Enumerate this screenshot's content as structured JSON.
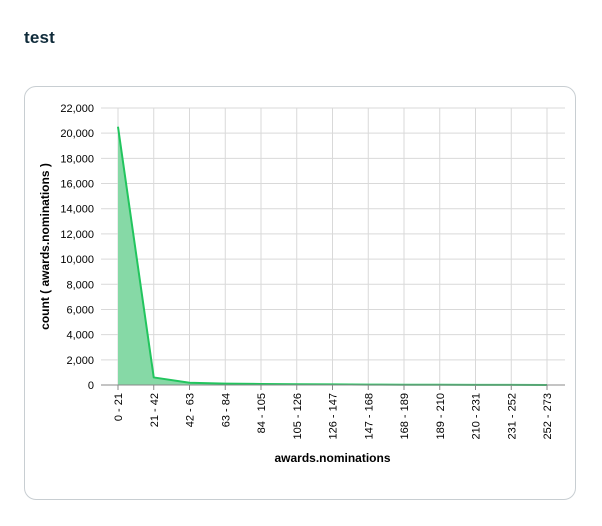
{
  "page": {
    "title": "test"
  },
  "colors": {
    "line": "#22c55e",
    "area": "#86d9a6"
  },
  "chart_data": {
    "type": "area",
    "title": "",
    "xlabel": "awards.nominations",
    "ylabel": "count ( awards.nominations )",
    "categories": [
      "0 - 21",
      "21 - 42",
      "42 - 63",
      "63 - 84",
      "84 - 105",
      "105 - 126",
      "126 - 147",
      "147 - 168",
      "168 - 189",
      "189 - 210",
      "210 - 231",
      "231 - 252",
      "252 - 273"
    ],
    "values": [
      20500,
      600,
      180,
      110,
      80,
      60,
      45,
      30,
      20,
      15,
      10,
      5,
      3
    ],
    "yticks": [
      "0",
      "2,000",
      "4,000",
      "6,000",
      "8,000",
      "10,000",
      "12,000",
      "14,000",
      "16,000",
      "18,000",
      "20,000",
      "22,000"
    ],
    "ylim": [
      0,
      22000
    ],
    "grid": true,
    "legend": "none"
  }
}
